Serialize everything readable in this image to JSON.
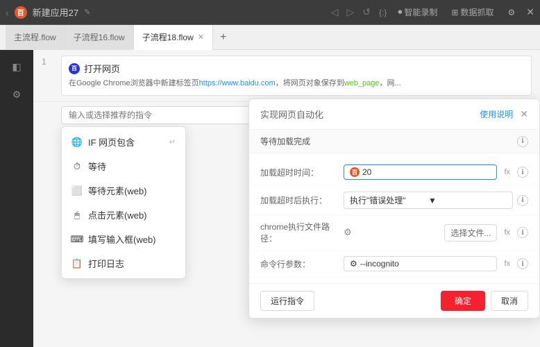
{
  "titlebar": {
    "app_name": "新建应用27",
    "edit_icon": "✎",
    "nav_back": "‹",
    "nav_forward": "›",
    "nav_refresh": "↺",
    "nav_stop": "✕",
    "controls": {
      "record": "智能录制",
      "extract": "数据抓取",
      "settings": "⚙"
    },
    "window_controls": {
      "minimize": "−",
      "maximize": "□",
      "close": "✕"
    }
  },
  "tabs": [
    {
      "label": "主流程.flow",
      "active": false,
      "closeable": false
    },
    {
      "label": "子流程16.flow",
      "active": false,
      "closeable": false
    },
    {
      "label": "子流程18.flow",
      "active": true,
      "closeable": true
    }
  ],
  "tab_add": "+",
  "flow": {
    "step_number": "1",
    "step_title": "打开网页",
    "step_desc_prefix": "在Google Chrome浏览器中新建标签页",
    "step_url": "https://www.baidu.com",
    "step_desc_mid": "，将网页对象保存到",
    "step_var": "web_page",
    "step_desc_suffix": "，网...",
    "command_placeholder": "输入或选择推荐的指令"
  },
  "dropdown": {
    "items": [
      {
        "icon": "🌐",
        "label": "IF 网页包含",
        "shortcut": "↵"
      },
      {
        "icon": "⏱",
        "label": "等待",
        "shortcut": ""
      },
      {
        "icon": "⬜",
        "label": "等待元素(web)",
        "shortcut": ""
      },
      {
        "icon": "🖱",
        "label": "点击元素(web)",
        "shortcut": ""
      },
      {
        "icon": "⌨",
        "label": "填写输入框(web)",
        "shortcut": ""
      },
      {
        "icon": "📋",
        "label": "打印日志",
        "shortcut": ""
      }
    ]
  },
  "dialog": {
    "title": "实现网页自动化",
    "help_link": "使用说明",
    "close_icon": "✕",
    "subtitle": "等待加载完成",
    "subtitle_info_icon": "ℹ",
    "rows": [
      {
        "label": "加载超时时间：",
        "type": "input-icon",
        "icon": "百",
        "value": "20",
        "has_fx": true,
        "has_info": true
      },
      {
        "label": "加载超时后执行：",
        "type": "select",
        "value": "执行\"错误处理\"",
        "has_info": true
      },
      {
        "label": "chrome执行文件路径：",
        "type": "file",
        "icon": "⚙",
        "choose_label": "选择文件...",
        "has_fx": true,
        "has_info": true
      },
      {
        "label": "命令行参数：",
        "type": "input-plain",
        "icon": "⚙",
        "value": "--incognito",
        "has_fx": true,
        "has_info": true
      }
    ],
    "run_btn": "运行指令",
    "confirm_btn": "确定",
    "cancel_btn": "取消"
  }
}
